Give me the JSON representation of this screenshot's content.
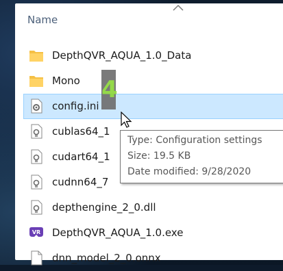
{
  "header": {
    "name_column": "Name",
    "sort_icon": "chevron-up-icon"
  },
  "files": [
    {
      "name": "DepthQVR_AQUA_1.0_Data",
      "icon": "folder-icon",
      "selected": false
    },
    {
      "name": "Mono",
      "icon": "folder-icon",
      "selected": false
    },
    {
      "name": "config.ini",
      "icon": "config-file-icon",
      "selected": true
    },
    {
      "name": "cublas64_1",
      "icon": "dll-file-icon",
      "selected": false
    },
    {
      "name": "cudart64_1",
      "icon": "dll-file-icon",
      "selected": false
    },
    {
      "name": "cudnn64_7",
      "icon": "dll-file-icon",
      "selected": false
    },
    {
      "name": "depthengine_2_0.dll",
      "icon": "dll-file-icon",
      "selected": false
    },
    {
      "name": "DepthQVR_AQUA_1.0.exe",
      "icon": "vr-app-icon",
      "selected": false
    },
    {
      "name": "dnn_model_2_0.onnx",
      "icon": "generic-file-icon",
      "selected": false
    }
  ],
  "annotation": {
    "step": "4"
  },
  "tooltip": {
    "type": "Type: Configuration settings",
    "size": "Size: 19.5 KB",
    "date": "Date modified: 9/28/2020"
  },
  "colors": {
    "selection_bg": "#cce8ff",
    "selection_border": "#99d1ff",
    "folder": "#f5c045",
    "badge_text": "#8bd63a"
  }
}
